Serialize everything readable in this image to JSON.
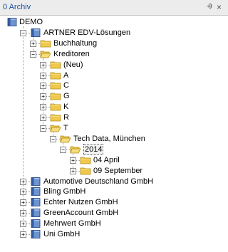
{
  "window": {
    "title": "0 Archiv",
    "pin_glyph": "⨮",
    "close_glyph": "×"
  },
  "tree": [
    {
      "label": "DEMO",
      "level": 0,
      "icon": "database-icon",
      "expander": "none"
    },
    {
      "label": "ARTNER EDV-Lösungen",
      "level": 1,
      "icon": "database-icon",
      "expander": "minus"
    },
    {
      "label": "Buchhaltung",
      "level": 2,
      "icon": "folder-icon",
      "expander": "plus"
    },
    {
      "label": "Kreditoren",
      "level": 2,
      "icon": "folder-open-icon",
      "expander": "minus"
    },
    {
      "label": "(Neu)",
      "level": 3,
      "icon": "folder-icon",
      "expander": "plus"
    },
    {
      "label": "A",
      "level": 3,
      "icon": "folder-icon",
      "expander": "plus"
    },
    {
      "label": "C",
      "level": 3,
      "icon": "folder-icon",
      "expander": "plus"
    },
    {
      "label": "G",
      "level": 3,
      "icon": "folder-icon",
      "expander": "plus"
    },
    {
      "label": "K",
      "level": 3,
      "icon": "folder-icon",
      "expander": "plus"
    },
    {
      "label": "R",
      "level": 3,
      "icon": "folder-icon",
      "expander": "plus"
    },
    {
      "label": "T",
      "level": 3,
      "icon": "folder-open-icon",
      "expander": "minus"
    },
    {
      "label": "Tech Data, München",
      "level": 4,
      "icon": "folder-open-icon",
      "expander": "minus"
    },
    {
      "label": "2014",
      "level": 5,
      "icon": "folder-open-icon",
      "expander": "minus",
      "selected": true
    },
    {
      "label": "04 April",
      "level": 6,
      "icon": "folder-icon",
      "expander": "plus"
    },
    {
      "label": "09 September",
      "level": 6,
      "icon": "folder-icon",
      "expander": "plus"
    },
    {
      "label": "Automotive Deutschland GmbH",
      "level": 1,
      "icon": "database-icon",
      "expander": "plus"
    },
    {
      "label": "Bling GmbH",
      "level": 1,
      "icon": "database-icon",
      "expander": "plus"
    },
    {
      "label": "Echter Nutzen GmbH",
      "level": 1,
      "icon": "database-icon",
      "expander": "plus"
    },
    {
      "label": "GreenAccount GmbH",
      "level": 1,
      "icon": "database-icon",
      "expander": "plus"
    },
    {
      "label": "Mehrwert GmbH",
      "level": 1,
      "icon": "database-icon",
      "expander": "plus"
    },
    {
      "label": "Uni GmbH",
      "level": 1,
      "icon": "database-icon",
      "expander": "plus"
    }
  ],
  "colors": {
    "folder": "#f0c94a",
    "folder_edge": "#b08a1e",
    "database": "#2f5ea8",
    "title": "#1f4fa0"
  }
}
